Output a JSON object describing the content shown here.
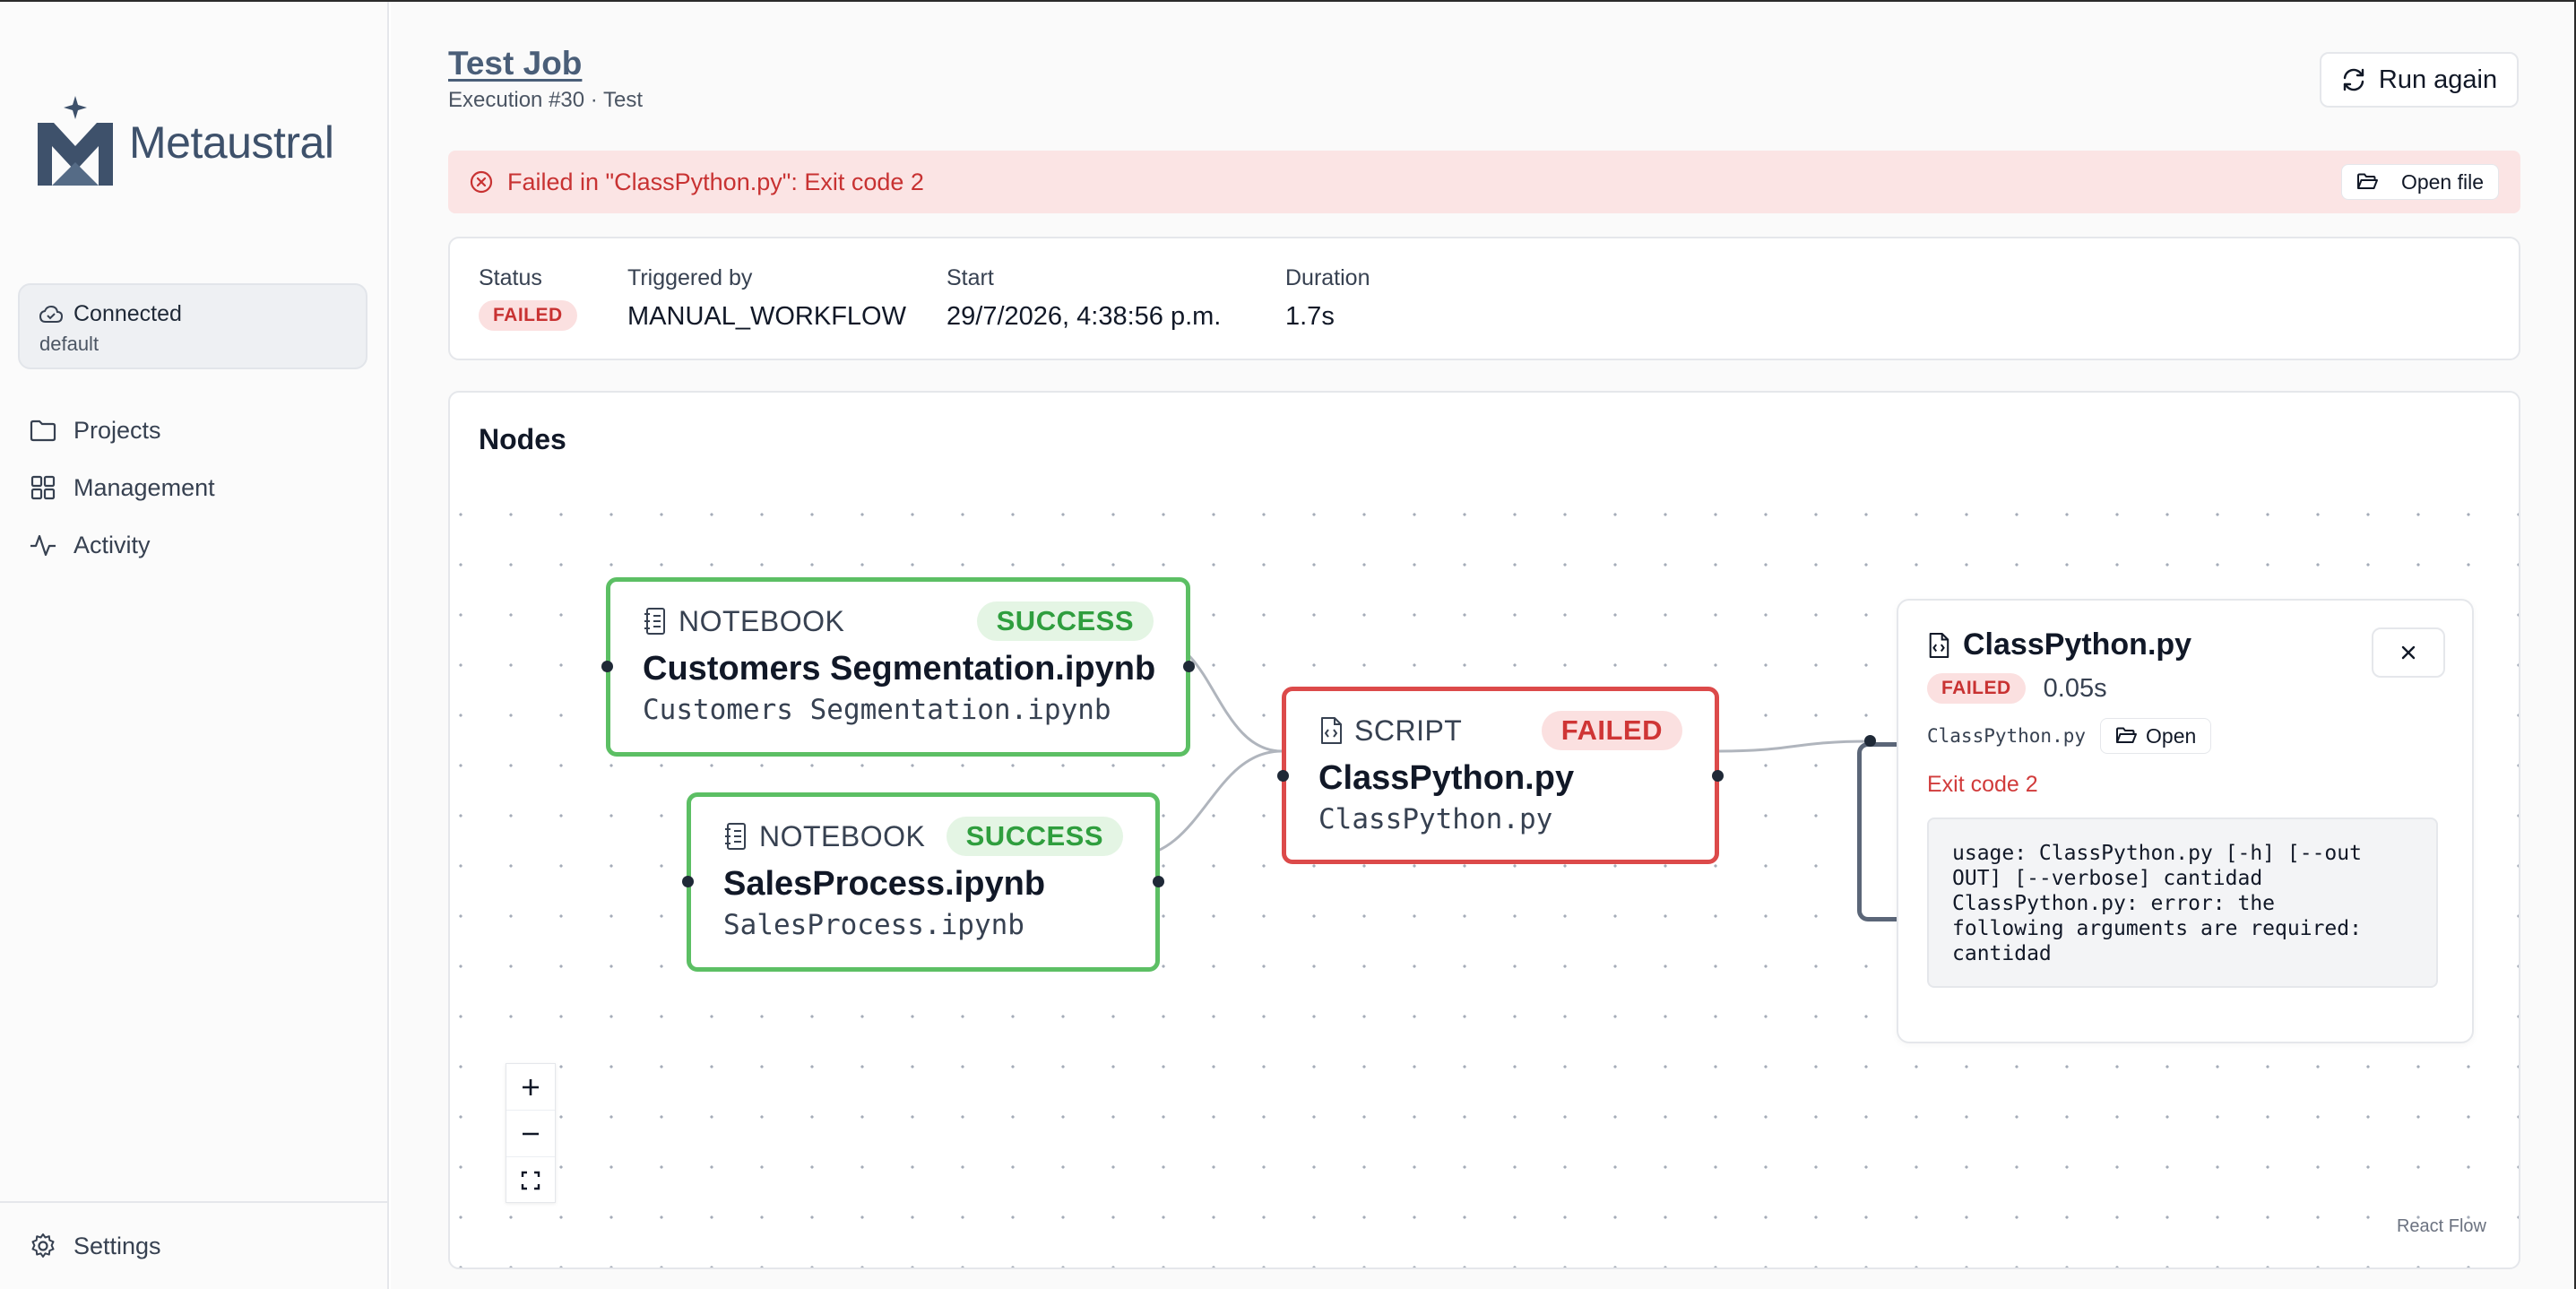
{
  "app": {
    "name": "Metaustral"
  },
  "connection": {
    "status": "Connected",
    "profile": "default"
  },
  "sidebar": {
    "items": [
      {
        "label": "Projects",
        "icon": "folder-icon"
      },
      {
        "label": "Management",
        "icon": "grid-icon"
      },
      {
        "label": "Activity",
        "icon": "activity-icon"
      }
    ],
    "settings_label": "Settings"
  },
  "job": {
    "title": "Test Job",
    "subtitle": "Execution #30 · Test",
    "run_again_label": "Run again"
  },
  "error_banner": {
    "message": "Failed in \"ClassPython.py\": Exit code 2",
    "open_file_label": "Open file"
  },
  "stats": {
    "status_label": "Status",
    "status_value": "FAILED",
    "triggered_label": "Triggered by",
    "triggered_value": "MANUAL_WORKFLOW",
    "start_label": "Start",
    "start_value": "29/7/2026, 4:38:56 p.m.",
    "duration_label": "Duration",
    "duration_value": "1.7s"
  },
  "nodes_section": {
    "title": "Nodes",
    "attribution": "React Flow",
    "nodes": [
      {
        "kind": "NOTEBOOK",
        "status": "SUCCESS",
        "name": "Customers Segmentation.ipynb",
        "file": "Customers Segmentation.ipynb"
      },
      {
        "kind": "NOTEBOOK",
        "status": "SUCCESS",
        "name": "SalesProcess.ipynb",
        "file": "SalesProcess.ipynb"
      },
      {
        "kind": "SCRIPT",
        "status": "FAILED",
        "name": "ClassPython.py",
        "file": "ClassPython.py"
      }
    ]
  },
  "detail_panel": {
    "title": "ClassPython.py",
    "status": "FAILED",
    "duration": "0.05s",
    "file": "ClassPython.py",
    "open_label": "Open",
    "exit_code": "Exit code 2",
    "log": "usage: ClassPython.py [-h] [--out\nOUT] [--verbose] cantidad\nClassPython.py: error: the\nfollowing arguments are required:\ncantidad"
  },
  "colors": {
    "success": "#5cbf64",
    "failed": "#dc4a4a",
    "brand": "#3e516b"
  }
}
